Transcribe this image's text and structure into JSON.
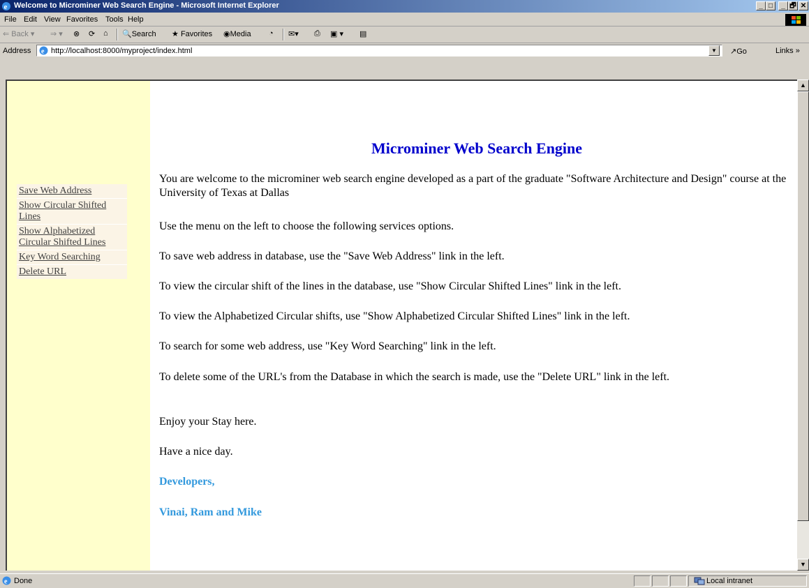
{
  "window": {
    "title": "Welcome to Microminer Web Search Engine - Microsoft Internet Explorer",
    "controls": [
      "_",
      "□",
      "_",
      "🗗",
      "✕"
    ]
  },
  "menu": {
    "items": [
      "File",
      "Edit",
      "View",
      "Favorites",
      "Tools",
      "Help"
    ]
  },
  "toolbar": {
    "back_label": "Back",
    "search_label": "Search",
    "favorites_label": "Favorites",
    "media_label": "Media"
  },
  "address": {
    "label": "Address",
    "url": "http://localhost:8000/myproject/index.html",
    "go_label": "Go",
    "links_label": "Links"
  },
  "sidebar": {
    "items": [
      "Save Web Address",
      "Show Circular Shifted Lines",
      "Show Alphabetized Circular Shifted Lines",
      "Key Word Searching",
      "Delete URL"
    ]
  },
  "page": {
    "heading": "Microminer Web Search Engine",
    "paragraphs": [
      "You are welcome to the microminer web search engine developed as a part of the graduate \"Software Architecture and Design\" course at the University of Texas at Dallas",
      "Use the menu on the left to choose the following services options.",
      "To save web address in database, use the \"Save Web Address\" link in the left.",
      "To view the circular shift of the lines in the database, use \"Show Circular Shifted Lines\" link in the left.",
      "To view the Alphabetized Circular shifts, use \"Show Alphabetized Circular Shifted Lines\" link in the left.",
      "To search for some web address, use \"Key Word Searching\" link in the left.",
      "To delete some of the URL's from the Database in which the search is made, use the \"Delete URL\" link in the left.",
      "Enjoy your Stay here.",
      "Have a nice day."
    ],
    "developers_label": "Developers,",
    "developers_names": "Vinai, Ram and Mike"
  },
  "status": {
    "text": "Done",
    "zone": "Local intranet"
  },
  "colors": {
    "sidebar_bg": "#ffffcc",
    "heading": "#0000cc",
    "developers": "#3399dd"
  }
}
